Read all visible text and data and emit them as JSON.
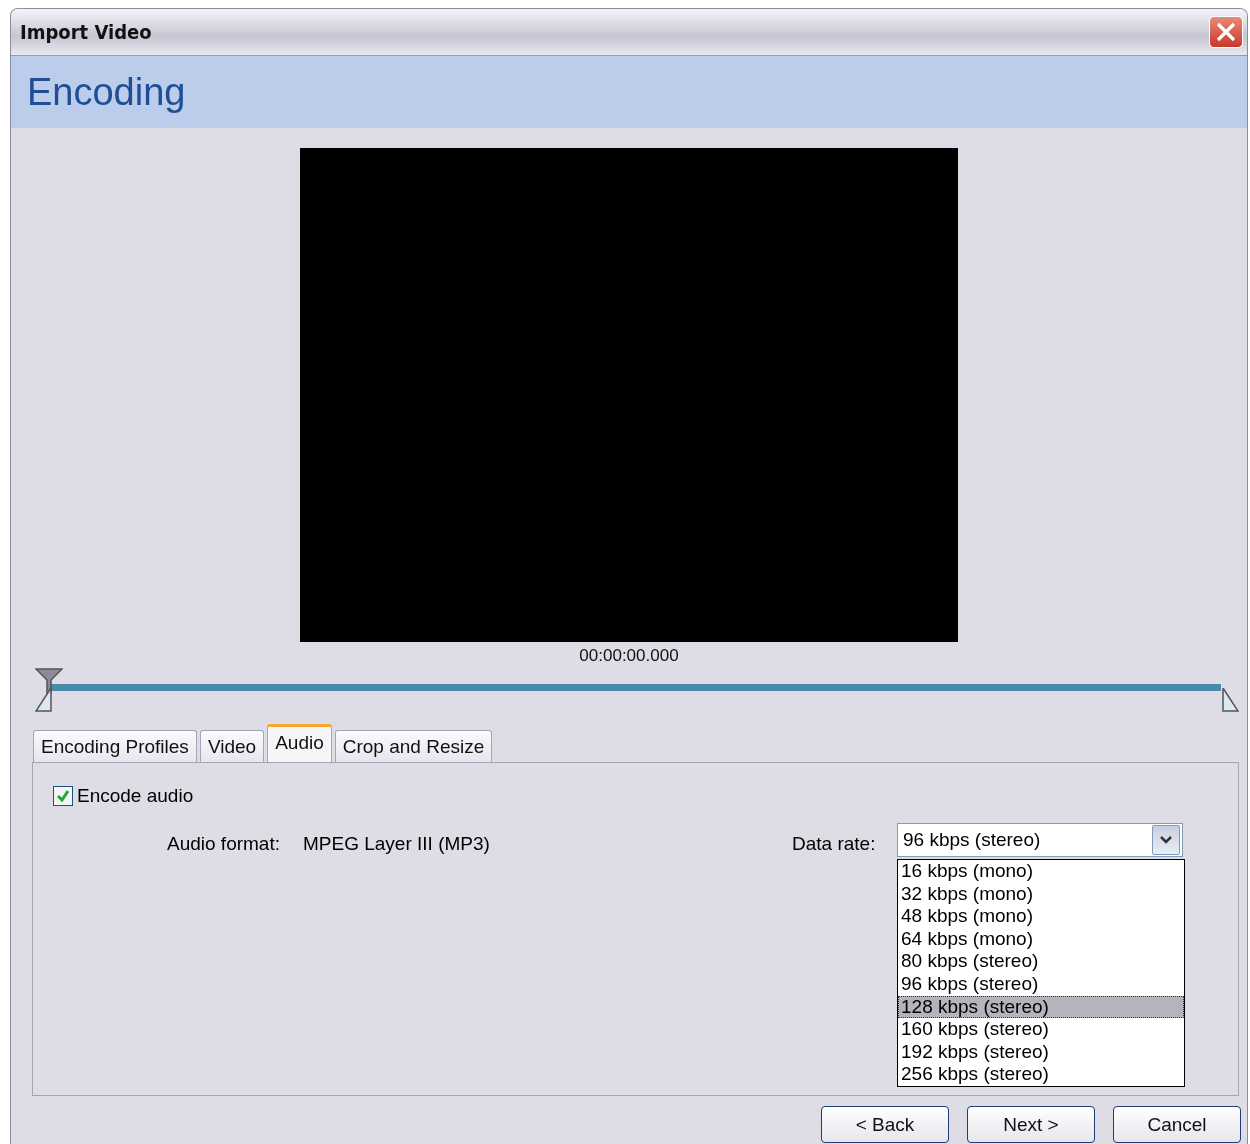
{
  "window": {
    "title": "Import Video"
  },
  "header": {
    "title": "Encoding"
  },
  "preview": {
    "timecode": "00:00:00.000"
  },
  "timeline": {
    "level": 0
  },
  "tabs": [
    {
      "label": "Encoding Profiles",
      "selected": false
    },
    {
      "label": "Video",
      "selected": false
    },
    {
      "label": "Audio",
      "selected": true
    },
    {
      "label": "Crop and Resize",
      "selected": false
    }
  ],
  "encode_audio": {
    "label": "Encode audio",
    "checked": true
  },
  "audio_format": {
    "label": "Audio format:",
    "value": "MPEG Layer III (MP3)"
  },
  "data_rate": {
    "label": "Data rate:",
    "value": "96 kbps (stereo)",
    "expanded": true,
    "options": [
      {
        "label": "16 kbps (mono)",
        "highlighted": false
      },
      {
        "label": "32 kbps (mono)",
        "highlighted": false
      },
      {
        "label": "48 kbps (mono)",
        "highlighted": false
      },
      {
        "label": "64 kbps (mono)",
        "highlighted": false
      },
      {
        "label": "80 kbps (stereo)",
        "highlighted": false
      },
      {
        "label": "96 kbps (stereo)",
        "highlighted": false
      },
      {
        "label": "128 kbps (stereo)",
        "highlighted": true
      },
      {
        "label": "160 kbps (stereo)",
        "highlighted": false
      },
      {
        "label": "192 kbps (stereo)",
        "highlighted": false
      },
      {
        "label": "256 kbps (stereo)",
        "highlighted": false
      }
    ]
  },
  "buttons": [
    "< Back",
    "Next >",
    "Cancel"
  ]
}
